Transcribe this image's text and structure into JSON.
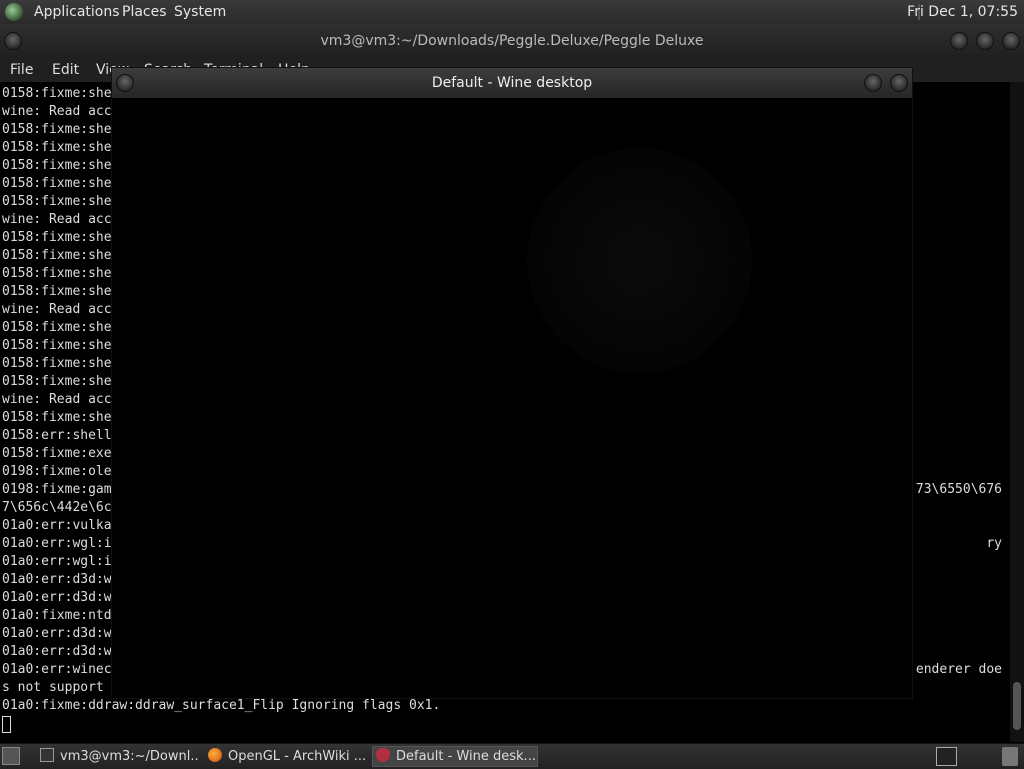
{
  "top_panel": {
    "menus": [
      "Applications",
      "Places",
      "System"
    ],
    "clock": "Fri Dec 1, 07:55"
  },
  "terminal": {
    "title": "vm3@vm3:~/Downloads/Peggle.Deluxe/Peggle Deluxe",
    "menus": [
      "File",
      "Edit",
      "View",
      "Search",
      "Terminal",
      "Help"
    ],
    "lines": [
      "0158:fixme:she",
      "wine: Read acc",
      "0158:fixme:she",
      "0158:fixme:she",
      "0158:fixme:she",
      "0158:fixme:she",
      "0158:fixme:she",
      "wine: Read acc",
      "0158:fixme:she",
      "0158:fixme:she",
      "0158:fixme:she",
      "0158:fixme:she",
      "wine: Read acc",
      "0158:fixme:she",
      "0158:fixme:she",
      "0158:fixme:she",
      "0158:fixme:she",
      "wine: Read acc",
      "0158:fixme:she",
      "0158:err:shell",
      "0158:fixme:exe",
      "0198:fixme:ole",
      "0198:fixme:gam",
      "7\\656c\\442e\\6c",
      "01a0:err:vulka",
      "01a0:err:wgl:i",
      "01a0:err:wgl:i",
      "01a0:err:d3d:w",
      "01a0:err:d3d:w",
      "01a0:fixme:ntd",
      "01a0:err:d3d:w",
      "01a0:err:d3d:w",
      "01a0:err:winec",
      "s not support",
      "01a0:fixme:ddraw:ddraw_surface1_Flip Ignoring flags 0x1."
    ],
    "right_fragments": [
      {
        "row": 22,
        "text": "73\\6550\\676"
      },
      {
        "row": 25,
        "text": "ry"
      },
      {
        "row": 32,
        "text": "enderer doe"
      }
    ]
  },
  "wine_window": {
    "title": "Default - Wine desktop"
  },
  "taskbar": {
    "tasks": [
      {
        "label": "vm3@vm3:~/Downl...",
        "icon": "terminal-icon",
        "active": false
      },
      {
        "label": "OpenGL - ArchWiki ...",
        "icon": "firefox-icon",
        "active": false
      },
      {
        "label": "Default - Wine desk...",
        "icon": "wine-icon",
        "active": true
      }
    ]
  },
  "colors": {
    "panel": "#2a2a2a",
    "terminal_bg": "#000000",
    "terminal_fg": "#dddddd",
    "firefox": "#e8731a",
    "wine": "#b03040"
  }
}
